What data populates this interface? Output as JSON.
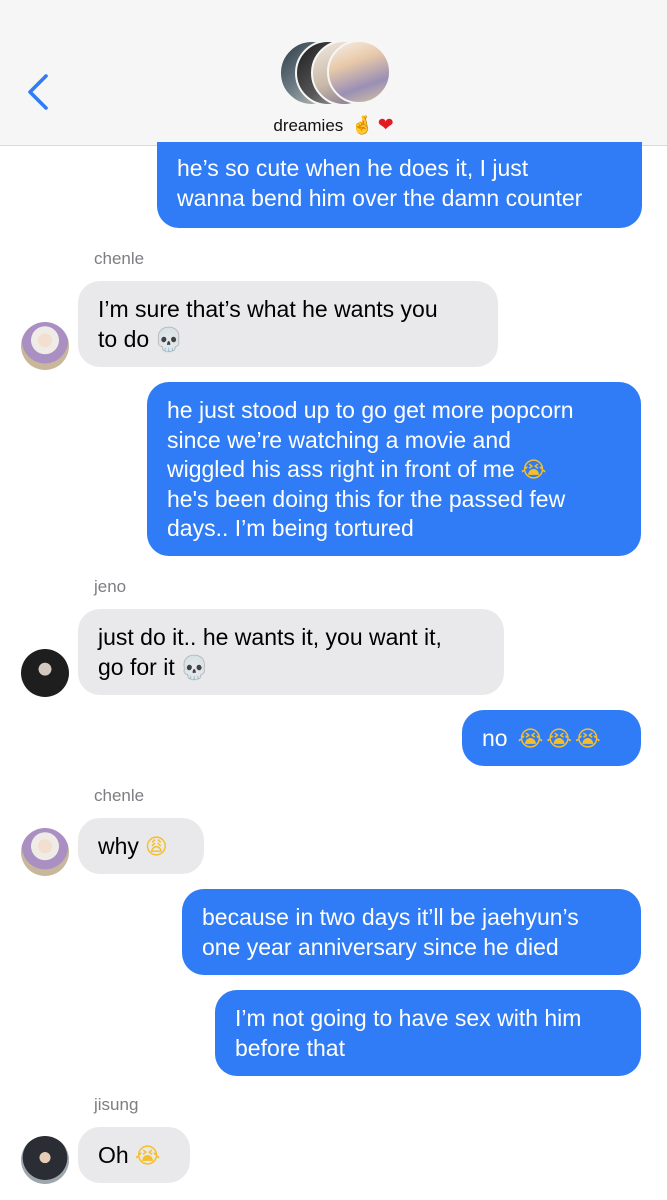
{
  "header": {
    "group_name": "dreamies",
    "emoji_hand": "🤞",
    "emoji_heart": "❤"
  },
  "messages": [
    {
      "id": "m1",
      "type": "sent",
      "lines": [
        "he’s so cute when he does it, I just",
        "wanna bend him over the damn counter"
      ]
    },
    {
      "id": "m2",
      "type": "received",
      "sender": "chenle",
      "lines": [
        "I’m sure that’s what he wants you",
        "to do"
      ],
      "emoji": "💀"
    },
    {
      "id": "m3",
      "type": "sent",
      "lines": [
        "he just stood up to go get more popcorn",
        "since we’re watching a movie and",
        "wiggled his ass right in front of me",
        "he's been doing this for the passed few",
        "days.. I’m being tortured"
      ],
      "emoji_line3": "😭"
    },
    {
      "id": "m4",
      "type": "received",
      "sender": "jeno",
      "lines": [
        "just do it.. he wants it, you want it,",
        "go for it"
      ],
      "emoji": "💀"
    },
    {
      "id": "m5",
      "type": "sent",
      "lines": [
        "no"
      ],
      "emoji": "😭😭😭"
    },
    {
      "id": "m6",
      "type": "received",
      "sender": "chenle",
      "lines": [
        "why"
      ],
      "emoji": "😩"
    },
    {
      "id": "m7",
      "type": "sent",
      "lines": [
        "because in two days it’ll be jaehyun’s",
        "one year anniversary since he died"
      ]
    },
    {
      "id": "m8",
      "type": "sent",
      "lines": [
        "I’m not going to have sex with him",
        "before that"
      ]
    },
    {
      "id": "m9",
      "type": "received",
      "sender": "jisung",
      "lines": [
        "Oh"
      ],
      "emoji": "😭"
    }
  ],
  "colors": {
    "sent_bubble": "#2f7cf6",
    "received_bubble": "#e9e9eb",
    "header_bg": "#f6f6f6",
    "back_arrow": "#2f7cf6"
  }
}
